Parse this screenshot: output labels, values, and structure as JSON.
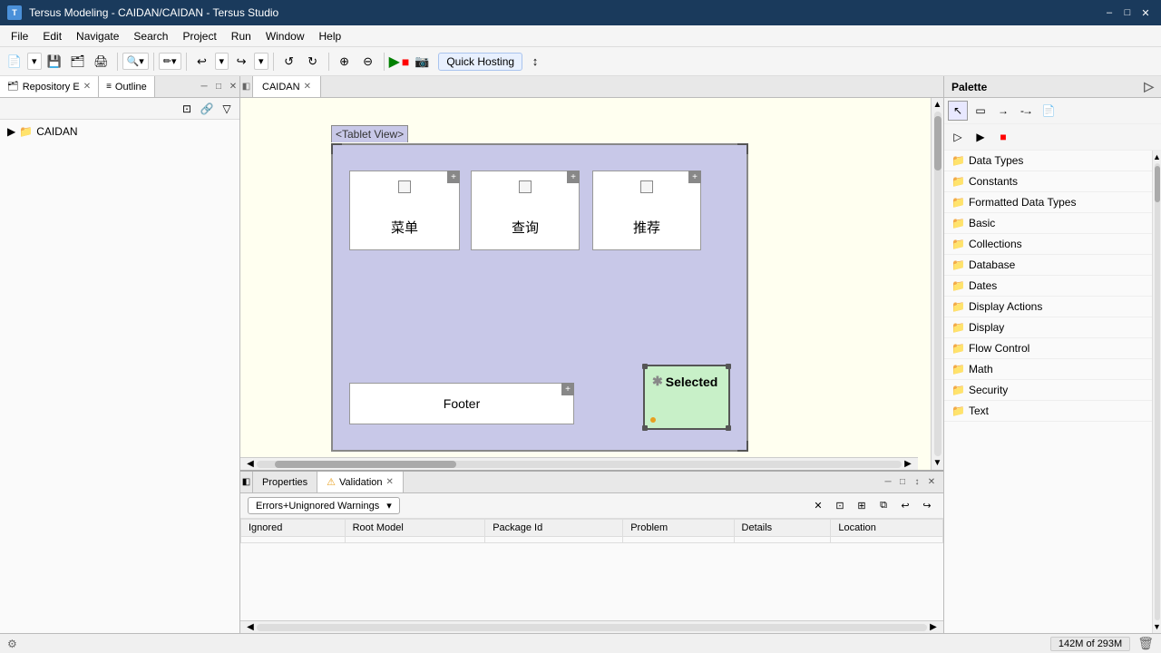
{
  "titlebar": {
    "title": "Tersus Modeling - CAIDAN/CAIDAN - Tersus Studio",
    "app_label": "T",
    "min": "–",
    "max": "□",
    "close": "✕"
  },
  "menubar": {
    "items": [
      "File",
      "Edit",
      "Navigate",
      "Search",
      "Project",
      "Run",
      "Window",
      "Help"
    ]
  },
  "toolbar": {
    "quick_hosting": "Quick Hosting",
    "play": "▶",
    "stop": "■"
  },
  "left_panel": {
    "tab1_label": "Repository E",
    "tab2_label": "Outline",
    "tree": {
      "root": "CAIDAN"
    }
  },
  "editor": {
    "tab_label": "CAIDAN",
    "canvas": {
      "view_title": "<Tablet View>",
      "boxes": [
        {
          "id": "box1",
          "label": "菜单"
        },
        {
          "id": "box2",
          "label": "查询"
        },
        {
          "id": "box3",
          "label": "推荐"
        }
      ],
      "footer_label": "Footer",
      "selected_label": "Selected",
      "selected_asterisk": "*"
    }
  },
  "palette": {
    "title": "Palette",
    "sections": [
      "Data Types",
      "Constants",
      "Formatted Data Types",
      "Basic",
      "Collections",
      "Database",
      "Dates",
      "Display Actions",
      "Display",
      "Flow Control",
      "Math",
      "Security",
      "Text"
    ]
  },
  "bottom_panel": {
    "tab1_label": "Properties",
    "tab2_label": "Validation",
    "dropdown_label": "Errors+Unignored Warnings",
    "table": {
      "headers": [
        "Ignored",
        "Root Model",
        "Package Id",
        "Problem",
        "Details",
        "Location"
      ],
      "rows": []
    }
  },
  "statusbar": {
    "left": "",
    "memory": "142M of 293M"
  }
}
